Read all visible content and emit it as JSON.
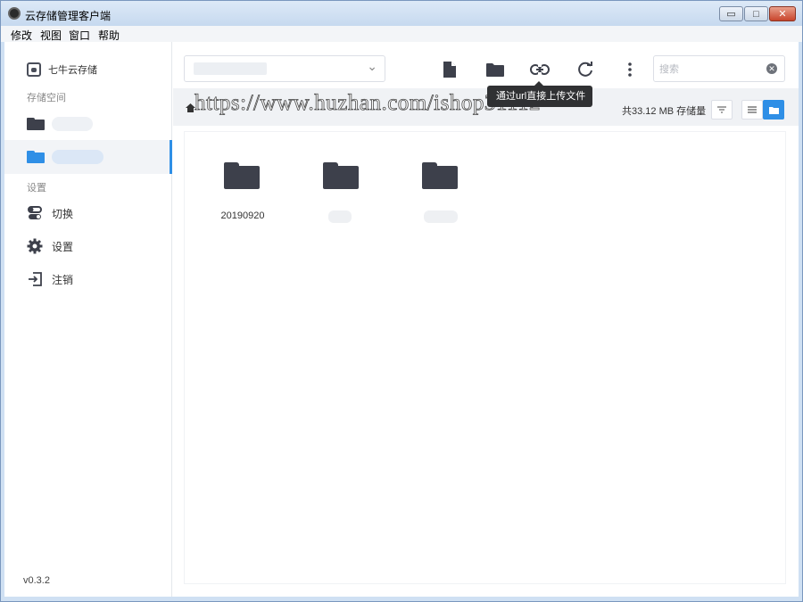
{
  "window": {
    "title": "云存储管理客户端",
    "controls": {
      "minimize": "▭",
      "maximize": "□",
      "close": "✕"
    }
  },
  "menu": [
    "修改",
    "视图",
    "窗口",
    "帮助"
  ],
  "sidebar": {
    "brand": "七牛云存储",
    "storage_section": "存储空间",
    "settings_section": "设置",
    "settings_items": [
      {
        "label": "切换",
        "icon": "toggle-icon"
      },
      {
        "label": "设置",
        "icon": "gear-icon"
      },
      {
        "label": "注销",
        "icon": "logout-icon"
      }
    ],
    "version": "v0.3.2"
  },
  "toolbar": {
    "search_placeholder": "搜索",
    "tooltip": "通过url直接上传文件",
    "icons": [
      "new-file-icon",
      "new-folder-icon",
      "link-icon",
      "refresh-icon",
      "more-icon"
    ]
  },
  "status": {
    "storage": "共33.12 MB 存储量"
  },
  "watermark": "https://www.huzhan.com/ishop31112",
  "files": [
    {
      "name": "20190920"
    },
    {
      "name": ""
    },
    {
      "name": ""
    }
  ],
  "colors": {
    "accent": "#2f8fe6",
    "folder": "#3d404b",
    "toolbar_bg": "#f0f2f5"
  }
}
